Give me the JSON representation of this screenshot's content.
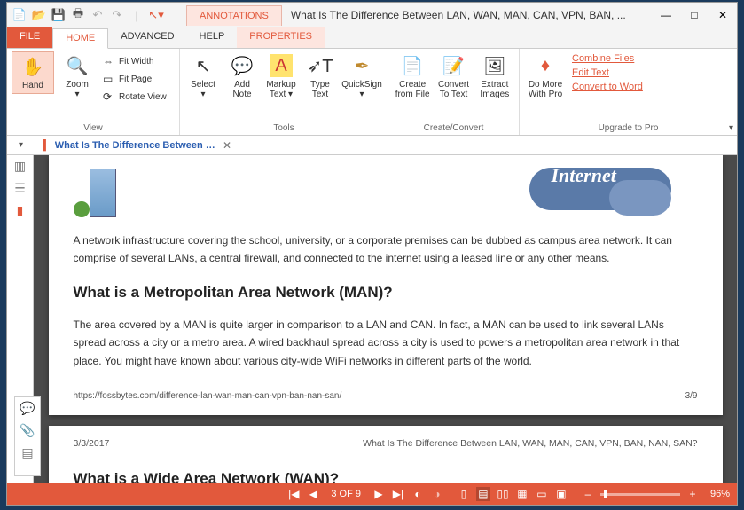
{
  "window": {
    "title": "What Is The Difference Between LAN, WAN, MAN, CAN, VPN, BAN, ...",
    "minimize": "—",
    "maximize": "□",
    "close": "✕"
  },
  "title_tabs": {
    "annotations": "ANNOTATIONS",
    "properties": "PROPERTIES"
  },
  "menu": {
    "file": "FILE",
    "home": "HOME",
    "advanced": "ADVANCED",
    "help": "HELP"
  },
  "ribbon": {
    "hand": "Hand",
    "zoom": "Zoom",
    "fit_width": "Fit Width",
    "fit_page": "Fit Page",
    "rotate_view": "Rotate View",
    "view_group": "View",
    "select": "Select",
    "add_note": "Add Note",
    "markup_text": "Markup Text",
    "type_text": "Type Text",
    "quicksign": "QuickSign",
    "tools_group": "Tools",
    "create_from_file": "Create from File",
    "convert_to_text": "Convert To Text",
    "extract_images": "Extract Images",
    "create_group": "Create/Convert",
    "do_more": "Do More With Pro",
    "combine_files": "Combine Files",
    "edit_text": "Edit Text",
    "convert_to_word": "Convert to Word",
    "upgrade_group": "Upgrade to Pro"
  },
  "doctab": {
    "title": "What Is The Difference Between LA..."
  },
  "doc": {
    "cloud_label": "Internet",
    "p1": "A network infrastructure covering the school, university, or a corporate premises can be dubbed as campus area network. It can comprise of several LANs, a central firewall, and connected to the internet using a leased line or any other means.",
    "h_man": "What is a Metropolitan Area Network (MAN)?",
    "p2": "The area covered by a MAN is quite larger in comparison to a LAN and CAN. In fact, a MAN can be used to link several LANs spread across a city or a metro area. A wired backhaul spread across a city is used to powers a metropolitan area network in that place. You might have known about various city-wide WiFi networks in different parts of the world.",
    "footer_url": "https://fossbytes.com/difference-lan-wan-man-can-vpn-ban-nan-san/",
    "footer_page": "3/9",
    "date": "3/3/2017",
    "header_title": "What Is The Difference Between LAN, WAN, MAN, CAN, VPN, BAN, NAN, SAN?",
    "h_wan": "What is a Wide Area Network (WAN)?"
  },
  "status": {
    "page_label": "3 OF 9",
    "zoom": "96%",
    "minus": "–",
    "plus": "+"
  }
}
